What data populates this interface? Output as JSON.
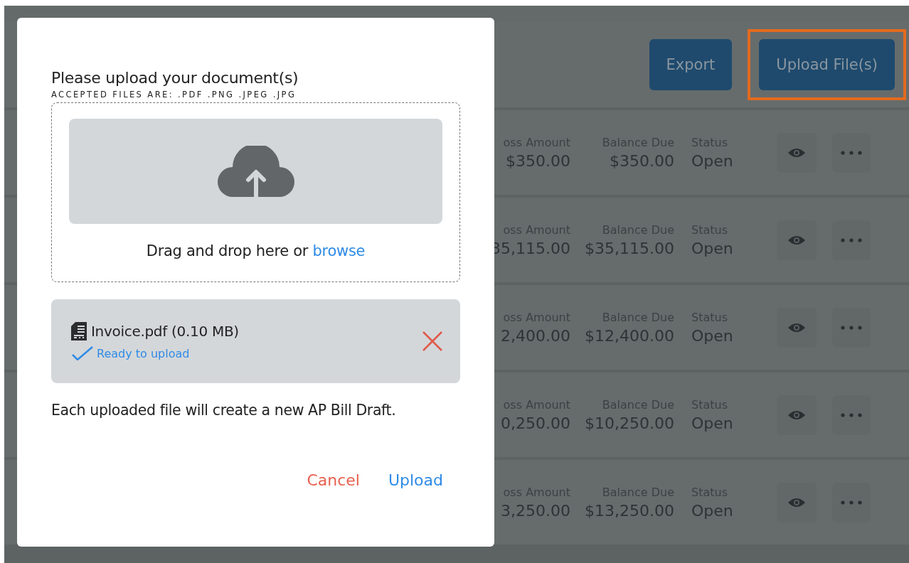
{
  "toolbar": {
    "buttons": [
      {
        "label": "Export",
        "highlighted": false
      },
      {
        "label": "Upload File(s)",
        "highlighted": true
      }
    ]
  },
  "rows": [
    {
      "gross_label": "oss Amount",
      "gross_value": "$350.00",
      "balance_label": "Balance Due",
      "balance_value": "$350.00",
      "status_label": "Status",
      "status_value": "Open"
    },
    {
      "gross_label": "oss Amount",
      "gross_value": "35,115.00",
      "balance_label": "Balance Due",
      "balance_value": "$35,115.00",
      "status_label": "Status",
      "status_value": "Open"
    },
    {
      "gross_label": "oss Amount",
      "gross_value": "2,400.00",
      "balance_label": "Balance Due",
      "balance_value": "$12,400.00",
      "status_label": "Status",
      "status_value": "Open"
    },
    {
      "gross_label": "oss Amount",
      "gross_value": "0,250.00",
      "balance_label": "Balance Due",
      "balance_value": "$10,250.00",
      "status_label": "Status",
      "status_value": "Open"
    },
    {
      "gross_label": "oss Amount",
      "gross_value": "3,250.00",
      "balance_label": "Balance Due",
      "balance_value": "$13,250.00",
      "status_label": "Status",
      "status_value": "Open"
    }
  ],
  "dialog": {
    "title": "Please upload your document(s)",
    "subtitle": "ACCEPTED FILES ARE: .PDF .PNG .JPEG .JPG",
    "dropzone": {
      "text": "Drag and drop here or",
      "link": "browse"
    },
    "files": [
      {
        "name": "Invoice.pdf (0.10 MB)",
        "status": "Ready to upload",
        "ready": true
      }
    ],
    "note": "Each uploaded file will create a new AP Bill Draft.",
    "actions": [
      {
        "label": "Cancel",
        "kind": "cancel"
      },
      {
        "label": "Upload",
        "kind": "confirm"
      }
    ]
  }
}
